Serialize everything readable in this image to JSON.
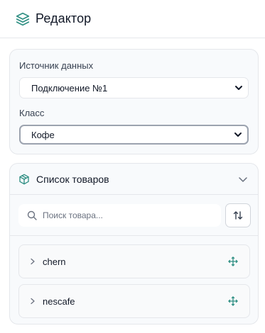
{
  "header": {
    "title": "Редактор",
    "icon": "layers-icon",
    "accent": "#2f8f83"
  },
  "source": {
    "data_source_label": "Источник данных",
    "data_source_value": "Подключение №1",
    "class_label": "Класс",
    "class_value": "Кофе"
  },
  "products": {
    "title": "Список товаров",
    "search_placeholder": "Поиск товара...",
    "items": [
      {
        "name": "chern"
      },
      {
        "name": "nescafe"
      }
    ]
  }
}
